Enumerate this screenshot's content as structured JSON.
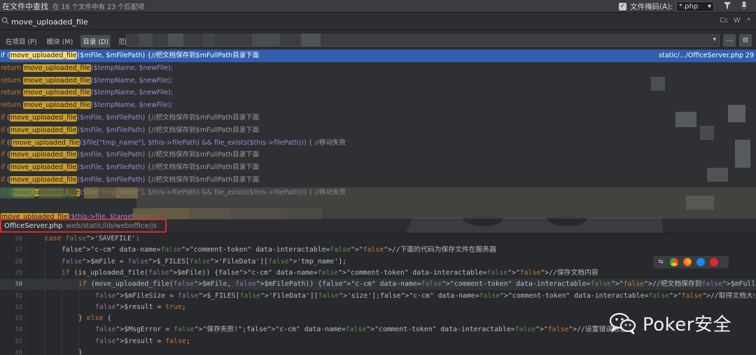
{
  "title_bar": {
    "title": "在文件中查找",
    "match_count": "在 16 个文件中有 23 个匹配项",
    "file_mask_checked": "✓",
    "file_mask_label": "文件掩码(A):",
    "file_mask_value": "*.php",
    "file_mask_caret": "▾",
    "filter_icon": "funnel-icon",
    "pin_icon": "pin-icon"
  },
  "search": {
    "query": "move_uploaded_file",
    "options": [
      "Cc",
      "W",
      ".*"
    ]
  },
  "scope": {
    "tabs": [
      {
        "label": "在项目 (P)",
        "active": false
      },
      {
        "label": "模块 (M)",
        "active": false
      },
      {
        "label": "目录 (D)",
        "active": true
      },
      {
        "label": "范围(S)",
        "active": false
      }
    ],
    "more_button": "...",
    "layout_button": "⊟"
  },
  "results": {
    "selected_location": "static/.../OfficeServer.php 29",
    "rows": [
      {
        "kind": "if1"
      },
      {
        "kind": "ret"
      },
      {
        "kind": "ret"
      },
      {
        "kind": "ret"
      },
      {
        "kind": "ret"
      },
      {
        "kind": "if1"
      },
      {
        "kind": "if1"
      },
      {
        "kind": "if2"
      },
      {
        "kind": "if1"
      },
      {
        "kind": "if1"
      },
      {
        "kind": "if1"
      },
      {
        "kind": "if2"
      },
      {
        "kind": "blank"
      },
      {
        "kind": "this"
      }
    ],
    "tokens": {
      "if": "if",
      "return": "return",
      "fn": "move_uploaded_file",
      "args_file": "($mFile, $mFilePath)",
      "args_temp": "($tempName, $newFile);",
      "comment_save": " {//把文档保存到$mFullPath目录下面",
      "paren_open": "(",
      "paren_double": "((",
      "args_files_tmp": "($file[\"tmp_name\"], $this->filePath) && file_exists($this->filePath))) {",
      "comment_move": " //移动失败",
      "args_this": "($this->file, $targetPath);"
    }
  },
  "file_path": {
    "name": "OfficeServer.php",
    "dir": "web/static/lib/weboffice/js"
  },
  "editor": {
    "lines": [
      {
        "no": "26",
        "text": "case 'SAVEFILE':"
      },
      {
        "no": "27",
        "text": "//下面的代码为保存文件在服务器"
      },
      {
        "no": "28",
        "text": "$mFile = $_FILES['FileData']['tmp_name'];"
      },
      {
        "no": "29",
        "text": "if (is_uploaded_file($mFile)) {//保存文档内容"
      },
      {
        "no": "30",
        "text": "if (move_uploaded_file($mFile, $mFilePath)) {//把文档保存到$mFullPath目录下面"
      },
      {
        "no": "31",
        "text": "$mFileSize = $_FILES['FileData']['size'];//取得文档大小"
      },
      {
        "no": "32",
        "text": "$result = true;"
      },
      {
        "no": "33",
        "text": "} else {"
      },
      {
        "no": "34",
        "text": "$MsgError = \"保存失败!\";//设置错误信息"
      },
      {
        "no": "35",
        "text": "$result = false;"
      },
      {
        "no": "36",
        "text": "}"
      }
    ]
  },
  "browser_bar": {
    "icons": [
      "preview-icon",
      "chrome-icon",
      "firefox-icon",
      "safari-icon",
      "opera-icon"
    ]
  },
  "watermark": {
    "text": "Poker安全"
  }
}
